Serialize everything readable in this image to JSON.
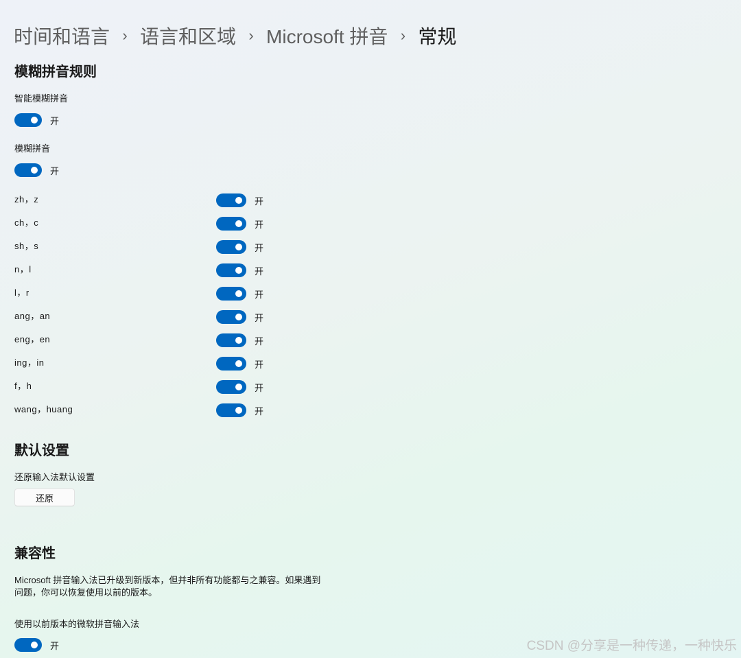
{
  "breadcrumb": {
    "items": [
      "时间和语言",
      "语言和区域",
      "Microsoft 拼音",
      "常规"
    ],
    "separator": "›"
  },
  "fuzzy_section": {
    "title": "模糊拼音规则",
    "smart_fuzzy": {
      "label": "智能模糊拼音",
      "state": "开",
      "on": true
    },
    "fuzzy": {
      "label": "模糊拼音",
      "state": "开",
      "on": true
    },
    "pairs": [
      {
        "label": "zh，z",
        "state": "开",
        "on": true
      },
      {
        "label": "ch，c",
        "state": "开",
        "on": true
      },
      {
        "label": "sh，s",
        "state": "开",
        "on": true
      },
      {
        "label": "n，l",
        "state": "开",
        "on": true
      },
      {
        "label": "l，r",
        "state": "开",
        "on": true
      },
      {
        "label": "ang，an",
        "state": "开",
        "on": true
      },
      {
        "label": "eng，en",
        "state": "开",
        "on": true
      },
      {
        "label": "ing，in",
        "state": "开",
        "on": true
      },
      {
        "label": "f，h",
        "state": "开",
        "on": true
      },
      {
        "label": "wang，huang",
        "state": "开",
        "on": true
      }
    ]
  },
  "default_section": {
    "title": "默认设置",
    "restore_label": "还原输入法默认设置",
    "restore_button": "还原"
  },
  "compat_section": {
    "title": "兼容性",
    "description": "Microsoft 拼音输入法已升级到新版本，但并非所有功能都与之兼容。如果遇到问题，你可以恢复使用以前的版本。",
    "previous_version": {
      "label": "使用以前版本的微软拼音输入法",
      "state": "开",
      "on": true
    }
  },
  "watermark": "CSDN @分享是一种传递，一种快乐",
  "colors": {
    "accent": "#0067c0",
    "text": "#1a1a1a",
    "breadcrumb_muted": "#5f5f5f"
  }
}
